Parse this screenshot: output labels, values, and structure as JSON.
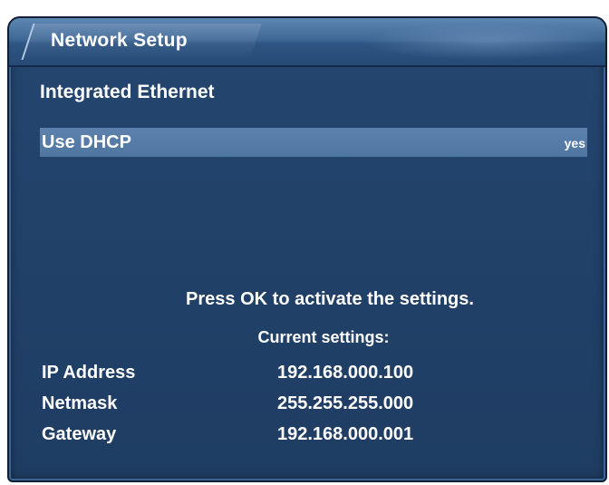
{
  "window": {
    "title": "Network Setup"
  },
  "section": {
    "title": "Integrated Ethernet"
  },
  "options": [
    {
      "label": "Use DHCP",
      "value": "yes"
    }
  ],
  "hint": "Press OK to activate the settings.",
  "current_settings": {
    "title": "Current settings:",
    "rows": [
      {
        "name": "IP Address",
        "value": "192.168.000.100"
      },
      {
        "name": "Netmask",
        "value": "255.255.255.000"
      },
      {
        "name": "Gateway",
        "value": "192.168.000.001"
      }
    ]
  },
  "colors": {
    "panel_background": "#22426a",
    "selection_highlight": "#5478a4",
    "text": "#ffffff"
  }
}
